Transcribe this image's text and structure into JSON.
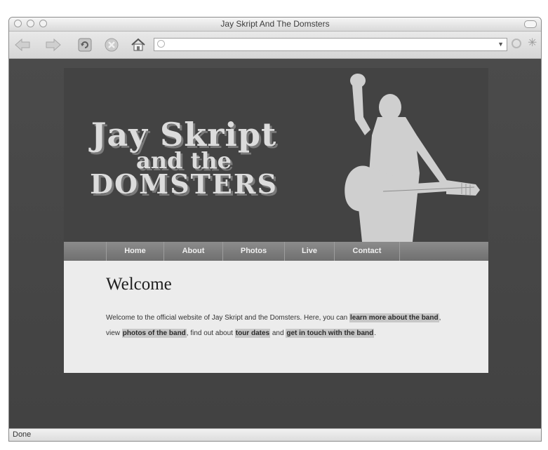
{
  "window": {
    "title": "Jay Skript And The Domsters"
  },
  "toolbar": {
    "back_icon": "back-arrow-icon",
    "forward_icon": "forward-arrow-icon",
    "reload_icon": "reload-icon",
    "stop_icon": "stop-icon",
    "home_icon": "home-icon",
    "address": {
      "value": "",
      "placeholder": ""
    }
  },
  "site": {
    "logo": {
      "line1": "Jay Skript",
      "line2": "and the",
      "line3": "DOMSTERS"
    },
    "nav": [
      "Home",
      "About",
      "Photos",
      "Live",
      "Contact"
    ],
    "main": {
      "heading": "Welcome",
      "intro1": "Welcome to the official website of Jay Skript and the Domsters. Here, you can ",
      "link1": "learn more about the band",
      "intro2": ", view ",
      "link2": "photos of the band",
      "intro3": ", find out about ",
      "link3": "tour dates",
      "intro4": " and ",
      "link4": "get in touch with the band",
      "intro5": "."
    }
  },
  "status": {
    "text": "Done"
  },
  "colors": {
    "page_background": "#454545",
    "header_background": "#434343",
    "nav_background": "#7d7d7d",
    "content_background": "#ececec",
    "silhouette": "#cfcfcf"
  }
}
